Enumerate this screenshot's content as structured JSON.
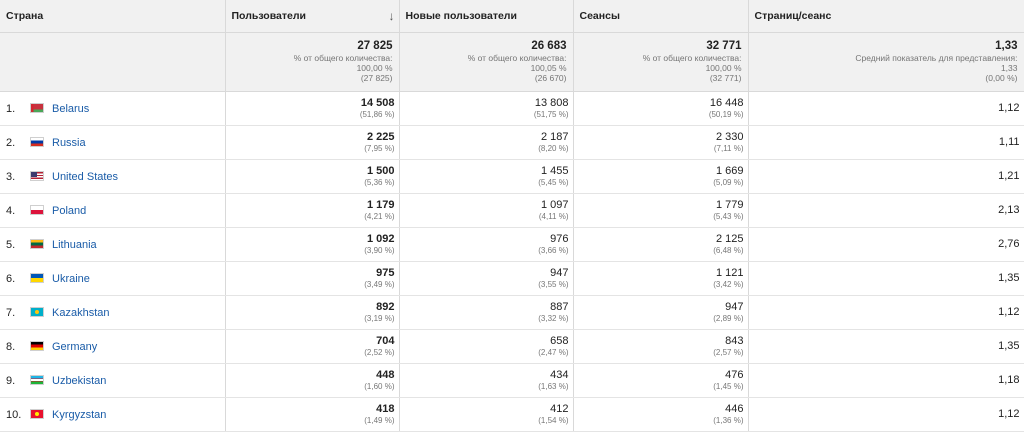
{
  "headers": {
    "country": "Страна",
    "users": "Пользователи",
    "new_users": "Новые пользователи",
    "sessions": "Сеансы",
    "pages_per_session": "Страниц/сеанс"
  },
  "sort_icon": "arrow-down-icon",
  "totals": {
    "users": {
      "value": "27 825",
      "label": "% от общего количества:",
      "pct": "100,00 %",
      "base": "(27 825)"
    },
    "new_users": {
      "value": "26 683",
      "label": "% от общего количества:",
      "pct": "100,05 %",
      "base": "(26 670)"
    },
    "sessions": {
      "value": "32 771",
      "label": "% от общего количества:",
      "pct": "100,00 %",
      "base": "(32 771)"
    },
    "pages_per_session": {
      "value": "1,33",
      "label": "Средний показатель для представления:",
      "pct": "1,33",
      "base": "(0,00 %)"
    }
  },
  "rows": [
    {
      "idx": "1.",
      "flag": "by",
      "country": "Belarus",
      "users": "14 508",
      "users_pct": "(51,86 %)",
      "new_users": "13 808",
      "new_users_pct": "(51,75 %)",
      "sessions": "16 448",
      "sessions_pct": "(50,19 %)",
      "pps": "1,12"
    },
    {
      "idx": "2.",
      "flag": "ru",
      "country": "Russia",
      "users": "2 225",
      "users_pct": "(7,95 %)",
      "new_users": "2 187",
      "new_users_pct": "(8,20 %)",
      "sessions": "2 330",
      "sessions_pct": "(7,11 %)",
      "pps": "1,11"
    },
    {
      "idx": "3.",
      "flag": "us",
      "country": "United States",
      "users": "1 500",
      "users_pct": "(5,36 %)",
      "new_users": "1 455",
      "new_users_pct": "(5,45 %)",
      "sessions": "1 669",
      "sessions_pct": "(5,09 %)",
      "pps": "1,21"
    },
    {
      "idx": "4.",
      "flag": "pl",
      "country": "Poland",
      "users": "1 179",
      "users_pct": "(4,21 %)",
      "new_users": "1 097",
      "new_users_pct": "(4,11 %)",
      "sessions": "1 779",
      "sessions_pct": "(5,43 %)",
      "pps": "2,13"
    },
    {
      "idx": "5.",
      "flag": "lt",
      "country": "Lithuania",
      "users": "1 092",
      "users_pct": "(3,90 %)",
      "new_users": "976",
      "new_users_pct": "(3,66 %)",
      "sessions": "2 125",
      "sessions_pct": "(6,48 %)",
      "pps": "2,76"
    },
    {
      "idx": "6.",
      "flag": "ua",
      "country": "Ukraine",
      "users": "975",
      "users_pct": "(3,49 %)",
      "new_users": "947",
      "new_users_pct": "(3,55 %)",
      "sessions": "1 121",
      "sessions_pct": "(3,42 %)",
      "pps": "1,35"
    },
    {
      "idx": "7.",
      "flag": "kz",
      "country": "Kazakhstan",
      "users": "892",
      "users_pct": "(3,19 %)",
      "new_users": "887",
      "new_users_pct": "(3,32 %)",
      "sessions": "947",
      "sessions_pct": "(2,89 %)",
      "pps": "1,12"
    },
    {
      "idx": "8.",
      "flag": "de",
      "country": "Germany",
      "users": "704",
      "users_pct": "(2,52 %)",
      "new_users": "658",
      "new_users_pct": "(2,47 %)",
      "sessions": "843",
      "sessions_pct": "(2,57 %)",
      "pps": "1,35"
    },
    {
      "idx": "9.",
      "flag": "uz",
      "country": "Uzbekistan",
      "users": "448",
      "users_pct": "(1,60 %)",
      "new_users": "434",
      "new_users_pct": "(1,63 %)",
      "sessions": "476",
      "sessions_pct": "(1,45 %)",
      "pps": "1,18"
    },
    {
      "idx": "10.",
      "flag": "kg",
      "country": "Kyrgyzstan",
      "users": "418",
      "users_pct": "(1,49 %)",
      "new_users": "412",
      "new_users_pct": "(1,54 %)",
      "sessions": "446",
      "sessions_pct": "(1,36 %)",
      "pps": "1,12"
    }
  ]
}
